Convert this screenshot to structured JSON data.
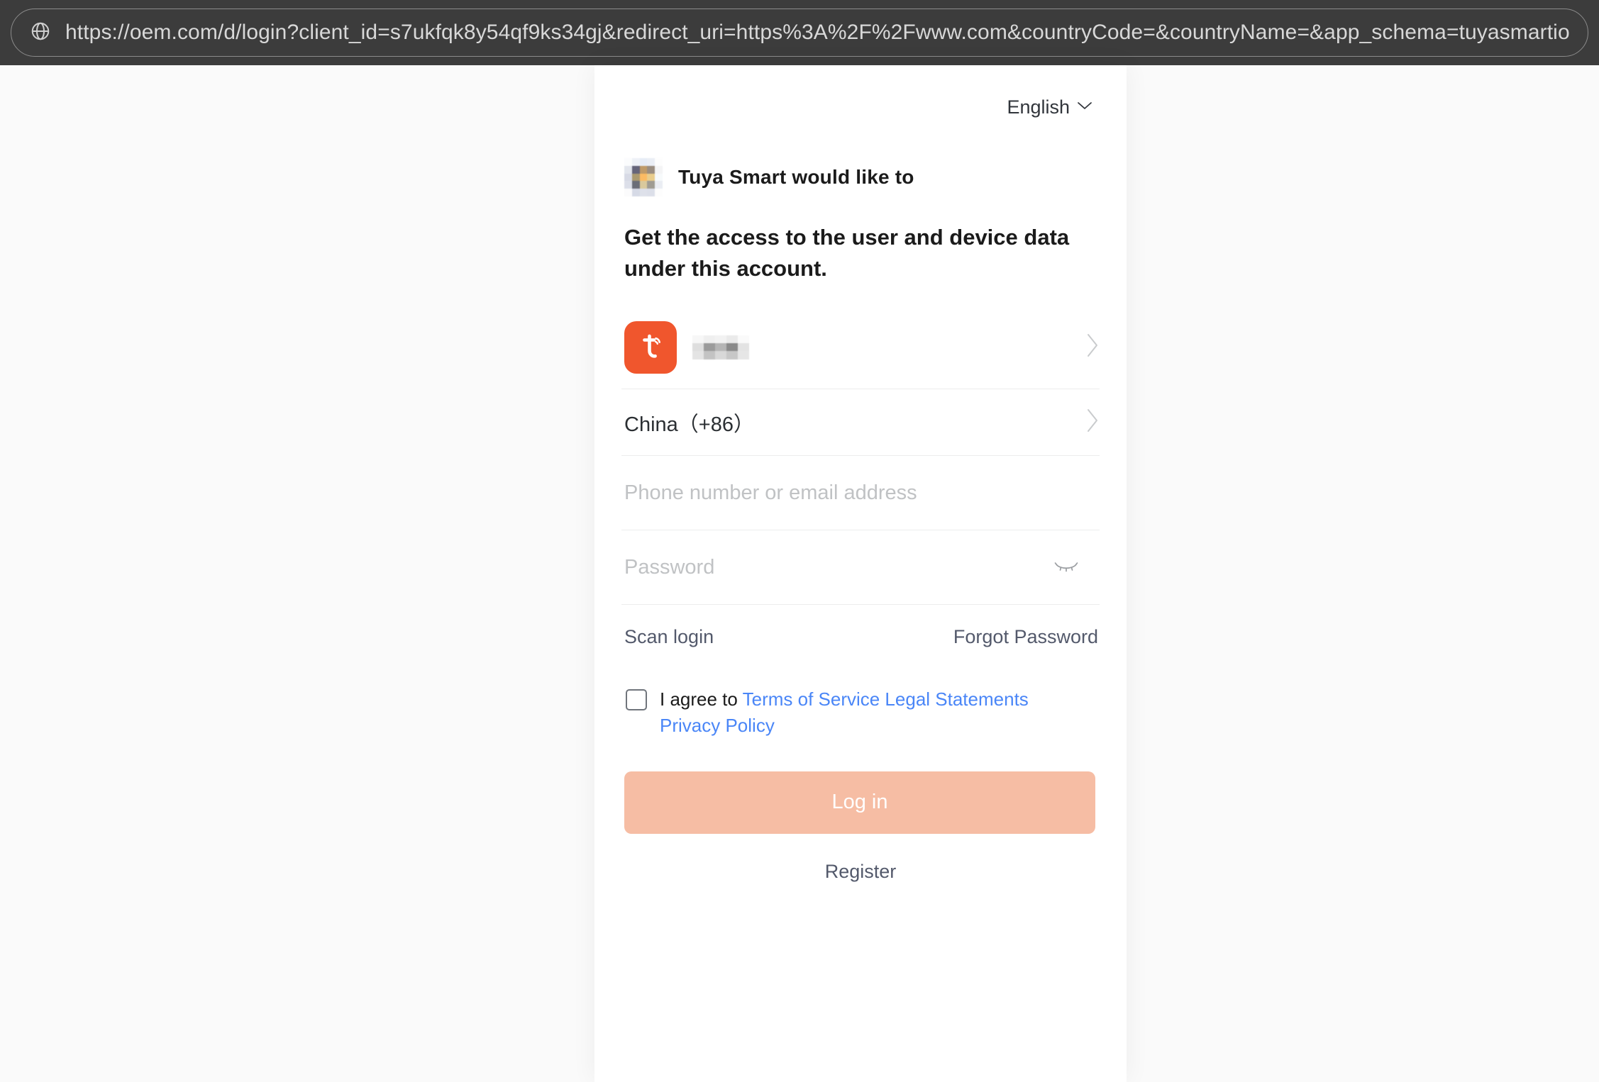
{
  "browser": {
    "url": "https://oem.com/d/login?client_id=s7ukfqk8y54qf9ks34gj&redirect_uri=https%3A%2F%2Fwww.com&countryCode=&countryName=&app_schema=tuyasmartiot",
    "globe_icon": "globe-icon",
    "chrome_bg": "#3c3c3c"
  },
  "language": {
    "label": "English",
    "chevron_icon": "chevron-down-icon"
  },
  "app": {
    "title": "Tuya Smart  would like to",
    "logo_icon": "pixelated-app-logo",
    "logo_colors": [
      "#fbfcfd",
      "#eef1f7",
      "#e6ecf6",
      "#eaeef5",
      "#fdfdfd",
      "#e3e6ed",
      "#65657a",
      "#bf9a68",
      "#9a8d80",
      "#f4f4f5",
      "#d7dae5",
      "#ab9a70",
      "#fbbb63",
      "#e9cd8c",
      "#f7fafb",
      "#dcdfe9",
      "#6b6e78",
      "#d9c99c",
      "#9f9c93",
      "#eaedf3",
      "#fbfbfc",
      "#d6dae6",
      "#dee1ea",
      "#dcdfe9",
      "#fdfdfd"
    ]
  },
  "heading": {
    "text": "Get the access to the user and device data under this account."
  },
  "account": {
    "app_icon": "tuya-app-icon",
    "icon_color": "#f0562d",
    "masked_username": "masked-username",
    "mask_colors": [
      "#f7f7f7",
      "#efefef",
      "#f2f2f2",
      "#eaeaea",
      "#fafafa",
      "#dedede",
      "#9b9b9b",
      "#b5b5b5",
      "#8a8a8a",
      "#e3e3e3",
      "#e4e4e4",
      "#c3c3c3",
      "#d8d8d8",
      "#c7c7c7",
      "#e6e6e6"
    ],
    "chevron_icon": "chevron-right-icon"
  },
  "country": {
    "label": "China（+86）",
    "chevron_icon": "chevron-right-icon"
  },
  "fields": {
    "account": {
      "placeholder": "Phone number or email address",
      "value": ""
    },
    "password": {
      "placeholder": "Password",
      "value": "",
      "toggle_icon": "eye-closed-icon"
    }
  },
  "links": {
    "scan_login": "Scan login",
    "forgot_password": "Forgot Password"
  },
  "agreement": {
    "checked": false,
    "prefix": "I agree to ",
    "terms_link": "Terms of Service Legal Statements",
    "privacy_link": "Privacy Policy",
    "link_color": "#4a86f7"
  },
  "actions": {
    "login_label": "Log in",
    "login_bg": "#f6bda4",
    "register_label": "Register"
  }
}
